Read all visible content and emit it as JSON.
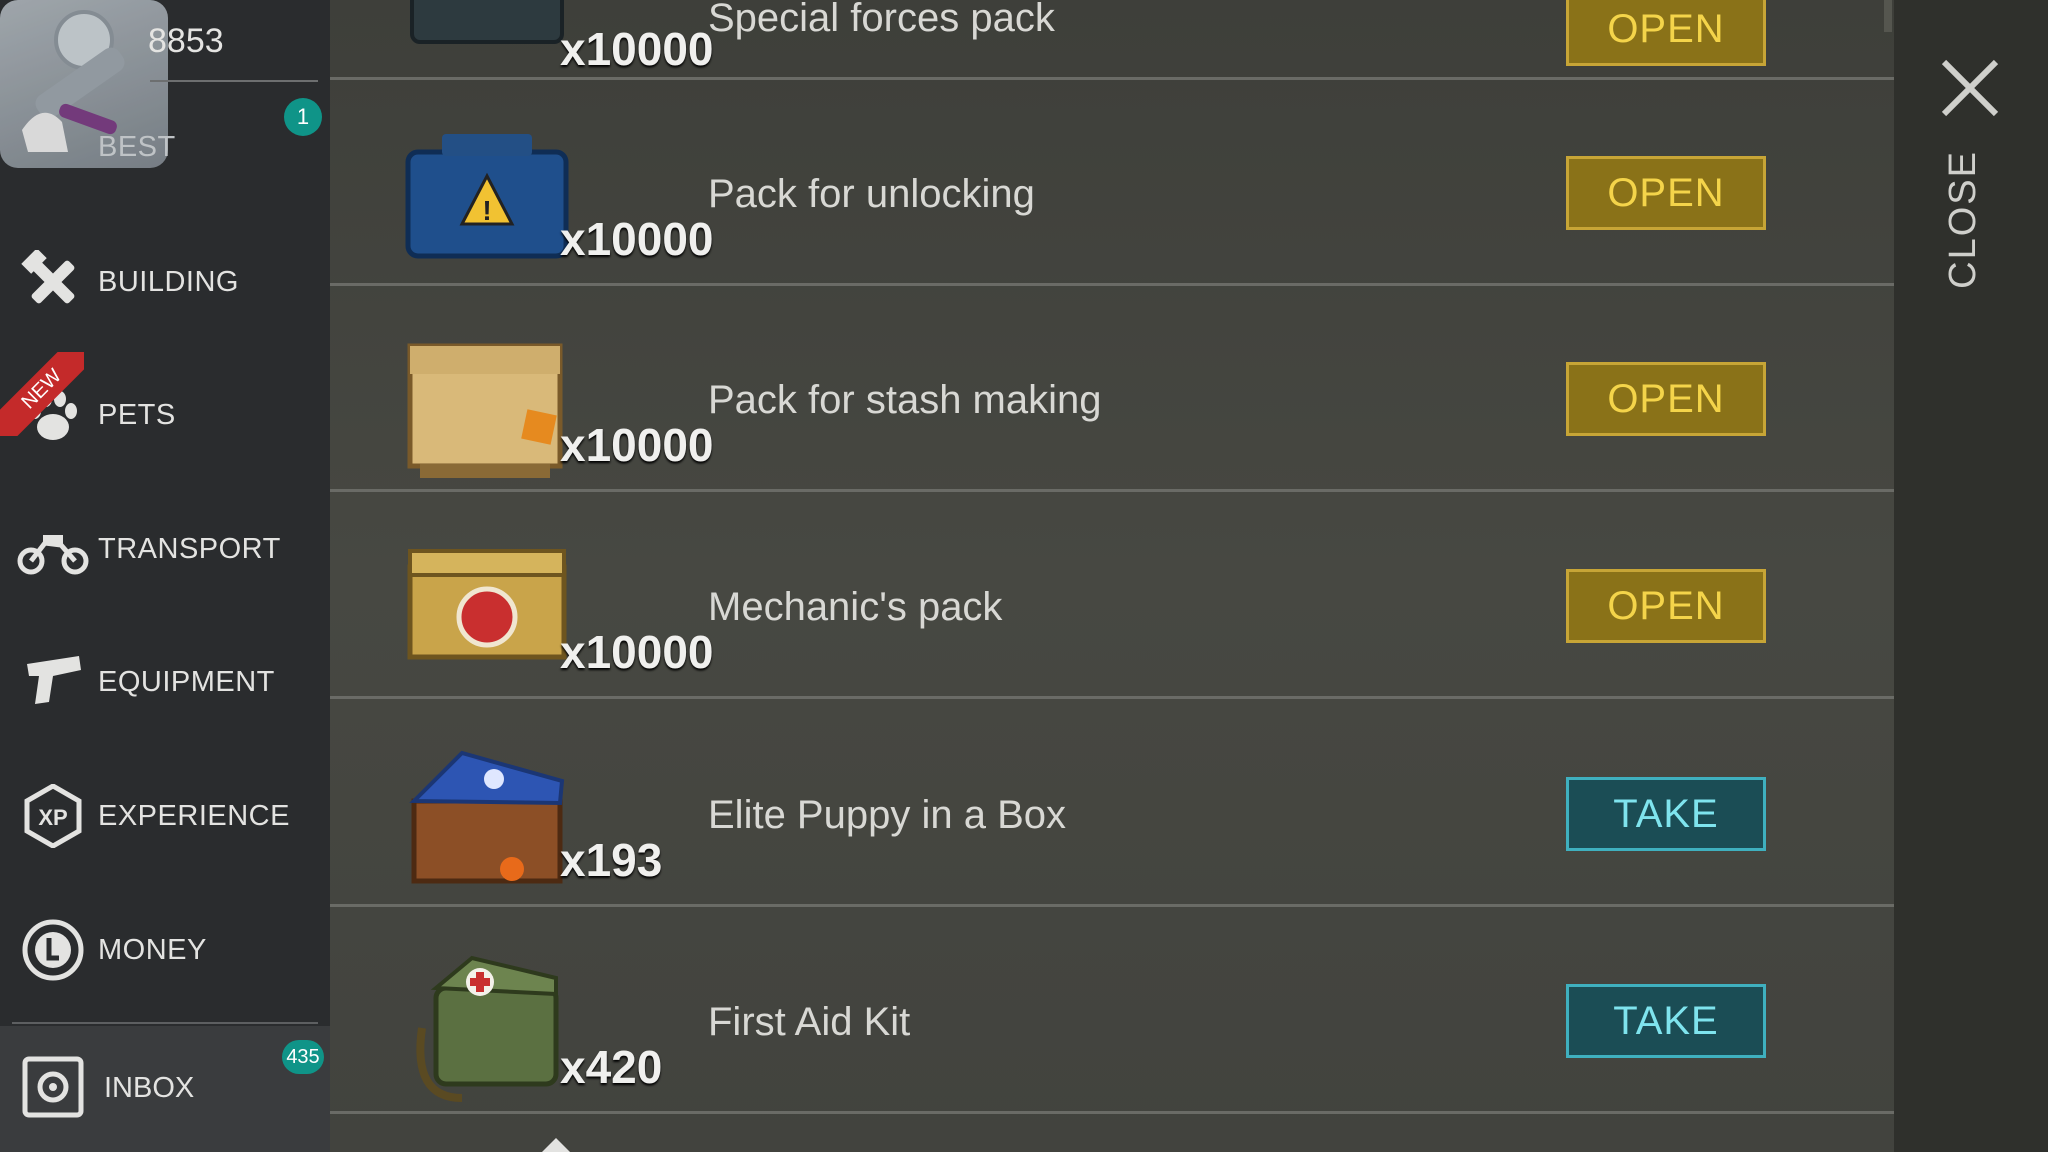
{
  "header": {
    "coins": "8853",
    "best_badge": "1"
  },
  "sidebar": {
    "items": [
      {
        "label": "BEST",
        "icon": "hand-icon"
      },
      {
        "label": "BUILDING",
        "icon": "hammer-wrench-icon"
      },
      {
        "label": "PETS",
        "icon": "paw-icon",
        "ribbon": "NEW"
      },
      {
        "label": "TRANSPORT",
        "icon": "motorcycle-icon"
      },
      {
        "label": "EQUIPMENT",
        "icon": "pistol-icon"
      },
      {
        "label": "EXPERIENCE",
        "icon": "xp-icon"
      },
      {
        "label": "MONEY",
        "icon": "coin-icon"
      }
    ],
    "inbox": {
      "label": "INBOX",
      "badge": "435"
    }
  },
  "items": [
    {
      "name": "Special forces pack",
      "qty": "x10000",
      "action": "OPEN"
    },
    {
      "name": "Pack for unlocking",
      "qty": "x10000",
      "action": "OPEN"
    },
    {
      "name": "Pack for stash making",
      "qty": "x10000",
      "action": "OPEN"
    },
    {
      "name": "Mechanic's pack",
      "qty": "x10000",
      "action": "OPEN"
    },
    {
      "name": "Elite Puppy in a Box",
      "qty": "x193",
      "action": "TAKE"
    },
    {
      "name": "First Aid Kit",
      "qty": "x420",
      "action": "TAKE"
    }
  ],
  "close": {
    "label": "CLOSE"
  },
  "colors": {
    "open_button": "#8a7218",
    "take_button": "#1b4d55",
    "badge": "#0f9488",
    "new_ribbon": "#c42a2a"
  }
}
